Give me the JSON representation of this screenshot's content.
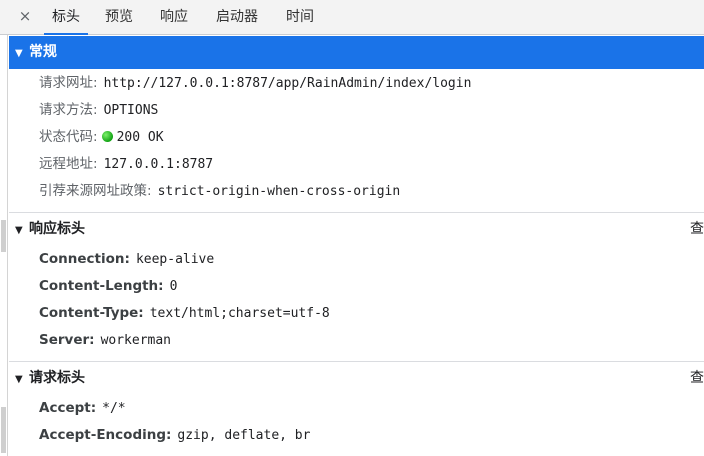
{
  "tabs": {
    "close_glyph": "×",
    "items": [
      {
        "label": "标头",
        "active": true
      },
      {
        "label": "预览",
        "active": false
      },
      {
        "label": "响应",
        "active": false
      },
      {
        "label": "启动器",
        "active": false
      },
      {
        "label": "时间",
        "active": false
      }
    ]
  },
  "general": {
    "title": "常规",
    "request_url": {
      "label": "请求网址:",
      "value": "http://127.0.0.1:8787/app/RainAdmin/index/login"
    },
    "request_method": {
      "label": "请求方法:",
      "value": "OPTIONS"
    },
    "status_code": {
      "label": "状态代码:",
      "value": "200 OK",
      "dot_color": "#12a314"
    },
    "remote_address": {
      "label": "远程地址:",
      "value": "127.0.0.1:8787"
    },
    "referrer_policy": {
      "label": "引荐来源网址政策:",
      "value": "strict-origin-when-cross-origin"
    }
  },
  "response_headers": {
    "title": "响应标头",
    "tail": "查",
    "items": [
      {
        "name": "Connection:",
        "value": "keep-alive"
      },
      {
        "name": "Content-Length:",
        "value": "0"
      },
      {
        "name": "Content-Type:",
        "value": "text/html;charset=utf-8"
      },
      {
        "name": "Server:",
        "value": "workerman"
      }
    ]
  },
  "request_headers": {
    "title": "请求标头",
    "tail": "查",
    "items": [
      {
        "name": "Accept:",
        "value": "*/*"
      },
      {
        "name": "Accept-Encoding:",
        "value": "gzip, deflate, br"
      }
    ]
  },
  "colors": {
    "accent": "#1a73e8",
    "status_ok": "#12a314"
  }
}
